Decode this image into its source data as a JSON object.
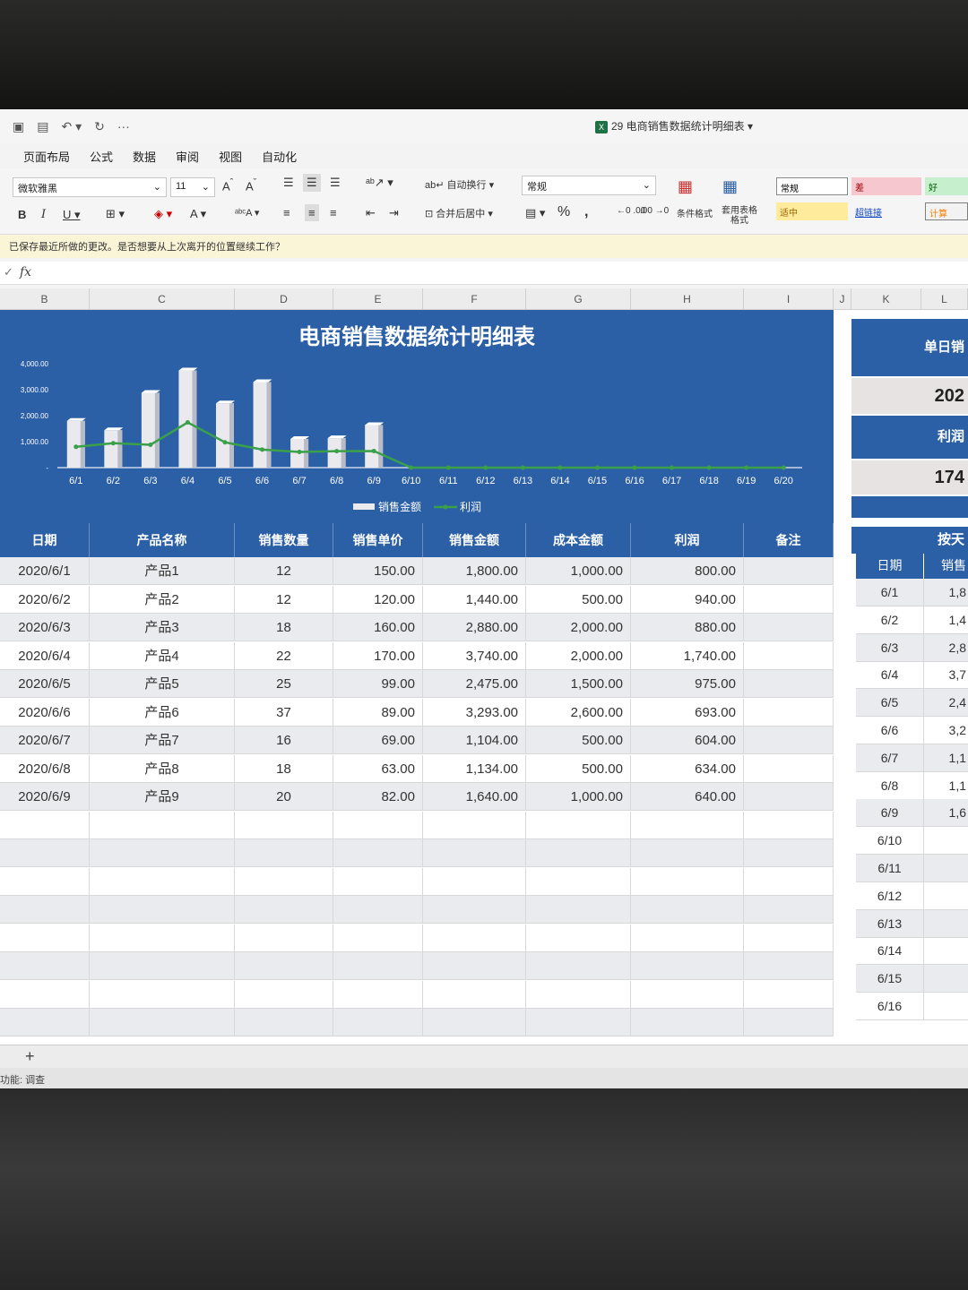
{
  "window": {
    "title": "29 电商销售数据统计明细表",
    "quick_access": [
      "save-icon",
      "save-as-icon",
      "undo-icon",
      "redo-icon",
      "more-icon"
    ]
  },
  "menu": [
    "页面布局",
    "公式",
    "数据",
    "审阅",
    "视图",
    "自动化"
  ],
  "ribbon": {
    "font_name": "微软雅黑",
    "font_size": "11",
    "wrap_text": "自动换行",
    "merge_center": "合并后居中",
    "number_format": "常规",
    "conditional_format": "条件格式",
    "table_format": "套用表格\n格式",
    "styles": [
      {
        "label": "常规",
        "bg": "#ffffff",
        "color": "#222222"
      },
      {
        "label": "差",
        "bg": "#f6c7ce",
        "color": "#9c0006"
      },
      {
        "label": "好",
        "bg": "#c6efce",
        "color": "#006100"
      },
      {
        "label": "适中",
        "bg": "#ffeb9c",
        "color": "#9c6500"
      },
      {
        "label": "超链接",
        "bg": "#f5f5f5",
        "color": "#0b44c5"
      },
      {
        "label": "计算",
        "bg": "#f2f2f2",
        "color": "#fa7d00"
      }
    ]
  },
  "notice": "已保存最近所做的更改。是否想要从上次离开的位置继续工作？",
  "columns": [
    "B",
    "C",
    "D",
    "E",
    "F",
    "G",
    "H",
    "I",
    "J",
    "K",
    "L"
  ],
  "dashboard": {
    "title": "电商销售数据统计明细表",
    "legend": [
      "销售金额",
      "利润"
    ]
  },
  "chart_data": {
    "type": "bar",
    "title": "电商销售数据统计明细表",
    "categories": [
      "6/1",
      "6/2",
      "6/3",
      "6/4",
      "6/5",
      "6/6",
      "6/7",
      "6/8",
      "6/9",
      "6/10",
      "6/11",
      "6/12",
      "6/13",
      "6/14",
      "6/15",
      "6/16",
      "6/17",
      "6/18",
      "6/19",
      "6/20"
    ],
    "y_ticks": [
      "4,000.00",
      "3,000.00",
      "2,000.00",
      "1,000.00",
      "-"
    ],
    "ylim": [
      0,
      4000
    ],
    "series": [
      {
        "name": "销售金额",
        "type": "bar",
        "color": "#e9e9ee",
        "values": [
          1800,
          1440,
          2880,
          3740,
          2475,
          3293,
          1104,
          1134,
          1640,
          0,
          0,
          0,
          0,
          0,
          0,
          0,
          0,
          0,
          0,
          0
        ]
      },
      {
        "name": "利润",
        "type": "line",
        "color": "#3aa04a",
        "values": [
          800,
          940,
          880,
          1740,
          975,
          693,
          604,
          634,
          640,
          0,
          0,
          0,
          0,
          0,
          0,
          0,
          0,
          0,
          0,
          0
        ]
      }
    ],
    "legend_position": "bottom"
  },
  "table": {
    "headers": [
      "日期",
      "产品名称",
      "销售数量",
      "销售单价",
      "销售金额",
      "成本金额",
      "利润",
      "备注"
    ],
    "rows": [
      [
        "2020/6/1",
        "产品1",
        "12",
        "150.00",
        "1,800.00",
        "1,000.00",
        "800.00",
        ""
      ],
      [
        "2020/6/2",
        "产品2",
        "12",
        "120.00",
        "1,440.00",
        "500.00",
        "940.00",
        ""
      ],
      [
        "2020/6/3",
        "产品3",
        "18",
        "160.00",
        "2,880.00",
        "2,000.00",
        "880.00",
        ""
      ],
      [
        "2020/6/4",
        "产品4",
        "22",
        "170.00",
        "3,740.00",
        "2,000.00",
        "1,740.00",
        ""
      ],
      [
        "2020/6/5",
        "产品5",
        "25",
        "99.00",
        "2,475.00",
        "1,500.00",
        "975.00",
        ""
      ],
      [
        "2020/6/6",
        "产品6",
        "37",
        "89.00",
        "3,293.00",
        "2,600.00",
        "693.00",
        ""
      ],
      [
        "2020/6/7",
        "产品7",
        "16",
        "69.00",
        "1,104.00",
        "500.00",
        "604.00",
        ""
      ],
      [
        "2020/6/8",
        "产品8",
        "18",
        "63.00",
        "1,134.00",
        "500.00",
        "634.00",
        ""
      ],
      [
        "2020/6/9",
        "产品9",
        "20",
        "82.00",
        "1,640.00",
        "1,000.00",
        "640.00",
        ""
      ]
    ]
  },
  "side_panel": {
    "label1": "单日销",
    "value1": "202",
    "label2": "利润",
    "value2": "174",
    "section_label": "按天",
    "headers": [
      "日期",
      "销售"
    ],
    "rows": [
      [
        "6/1",
        "1,8"
      ],
      [
        "6/2",
        "1,4"
      ],
      [
        "6/3",
        "2,8"
      ],
      [
        "6/4",
        "3,7"
      ],
      [
        "6/5",
        "2,4"
      ],
      [
        "6/6",
        "3,2"
      ],
      [
        "6/7",
        "1,1"
      ],
      [
        "6/8",
        "1,1"
      ],
      [
        "6/9",
        "1,6"
      ],
      [
        "6/10",
        ""
      ],
      [
        "6/11",
        ""
      ],
      [
        "6/12",
        ""
      ],
      [
        "6/13",
        ""
      ],
      [
        "6/14",
        ""
      ],
      [
        "6/15",
        ""
      ],
      [
        "6/16",
        ""
      ]
    ]
  },
  "tabs": {
    "add_label": "+"
  },
  "status": "功能: 调查"
}
